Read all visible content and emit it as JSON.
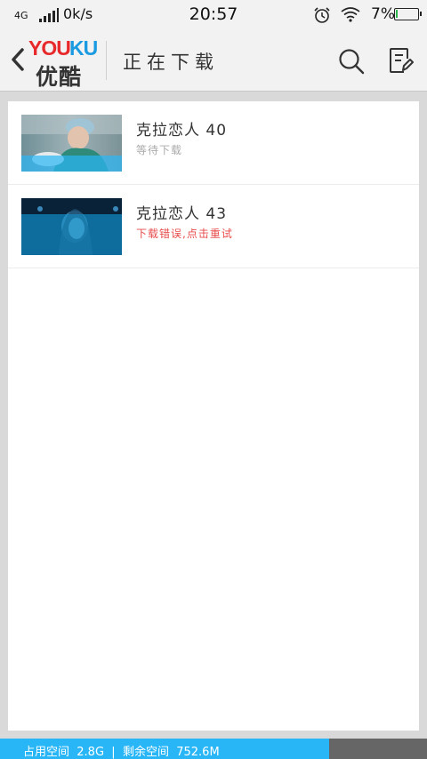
{
  "status_bar": {
    "network": "4G",
    "speed": "0k/s",
    "time": "20:57",
    "battery": "7%",
    "battery_level_percent": 7
  },
  "header": {
    "logo_latin_1": "YOU",
    "logo_latin_2": "KU",
    "logo_chinese": "优酷",
    "title": "正在下载",
    "colors": {
      "logo_red": "#e8292c",
      "logo_blue": "#1a9ae1"
    }
  },
  "downloads": [
    {
      "title": "克拉恋人 40",
      "status": "等待下载",
      "status_color": "#aaaaaa"
    },
    {
      "title": "克拉恋人 43",
      "status": "下载错误,点击重试",
      "status_color": "#e84d4d"
    }
  ],
  "footer": {
    "used_label": "占用空间",
    "used_value": "2.8G",
    "separator": "|",
    "free_label": "剩余空间",
    "free_value": "752.6M",
    "used_fraction": 0.77,
    "colors": {
      "used": "#29b6f6",
      "free": "#666666"
    }
  }
}
